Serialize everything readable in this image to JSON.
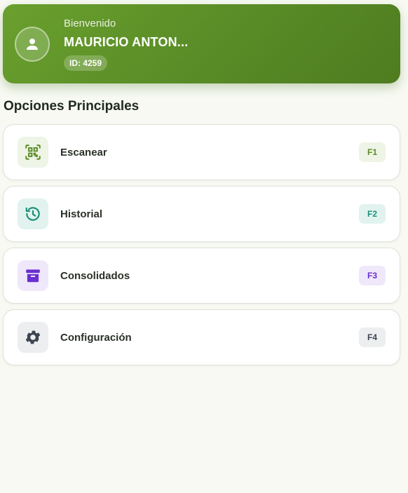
{
  "header": {
    "welcome": "Bienvenido",
    "user_name": "MAURICIO ANTON...",
    "user_id": "ID: 4259",
    "icon": "user-icon"
  },
  "section_title": "Opciones Principales",
  "menu": {
    "items": [
      {
        "label": "Escanear",
        "shortcut": "F1",
        "icon": "qr-scan-icon",
        "color": "#5a8d27",
        "icon_bg": "#eef4e6",
        "badge_bg": "#eef4e6"
      },
      {
        "label": "Historial",
        "shortcut": "F2",
        "icon": "history-icon",
        "color": "#1a8f7a",
        "icon_bg": "#e2f3ef",
        "badge_bg": "#e2f3ef"
      },
      {
        "label": "Consolidados",
        "shortcut": "F3",
        "icon": "archive-icon",
        "color": "#6a2fd1",
        "icon_bg": "#efe8fb",
        "badge_bg": "#efe8fb"
      },
      {
        "label": "Configuración",
        "shortcut": "F4",
        "icon": "gear-icon",
        "color": "#3d4450",
        "icon_bg": "#eceef0",
        "badge_bg": "#eceef0"
      }
    ]
  }
}
